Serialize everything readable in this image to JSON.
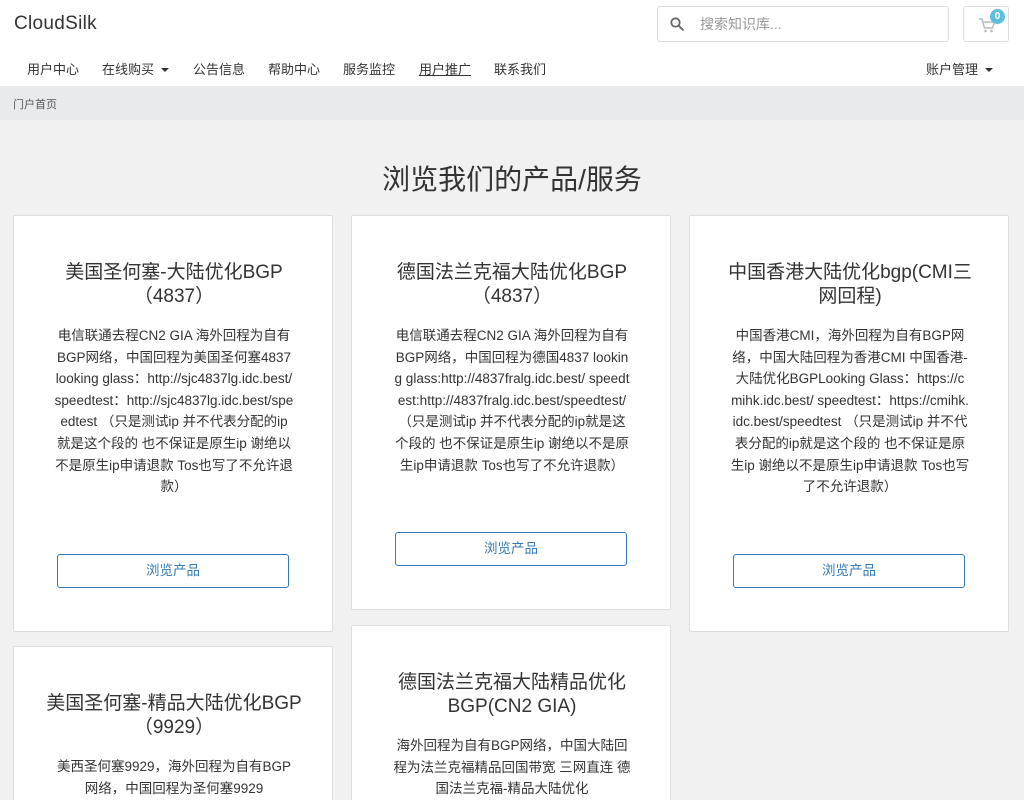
{
  "header": {
    "logo": "CloudSilk",
    "search_placeholder": "搜索知识库...",
    "cart_count": "0"
  },
  "nav": {
    "items": [
      {
        "label": "用户中心"
      },
      {
        "label": "在线购买"
      },
      {
        "label": "公告信息"
      },
      {
        "label": "帮助中心"
      },
      {
        "label": "服务监控"
      },
      {
        "label": "用户推广"
      },
      {
        "label": "联系我们"
      }
    ],
    "account": "账户管理"
  },
  "breadcrumb": "门户首页",
  "page_title": "浏览我们的产品/服务",
  "products": [
    {
      "title": "美国圣何塞-大陆优化BGP（4837）",
      "desc": "电信联通去程CN2 GIA 海外回程为自有BGP网络，中国回程为美国圣何塞4837 looking glass：http://sjc4837lg.idc.best/ speedtest：http://sjc4837lg.idc.best/speedtest （只是测试ip 并不代表分配的ip就是这个段的 也不保证是原生ip 谢绝以不是原生ip申请退款 Tos也写了不允许退款）",
      "button": "浏览产品"
    },
    {
      "title": "德国法兰克福大陆优化BGP（4837）",
      "desc": "电信联通去程CN2 GIA 海外回程为自有BGP网络，中国回程为德国4837 looking glass:http://4837fralg.idc.best/ speedtest:http://4837fralg.idc.best/speedtest/ （只是测试ip 并不代表分配的ip就是这个段的 也不保证是原生ip 谢绝以不是原生ip申请退款 Tos也写了不允许退款）",
      "button": "浏览产品"
    },
    {
      "title": "中国香港大陆优化bgp(CMI三网回程)",
      "desc": "中国香港CMI，海外回程为自有BGP网络，中国大陆回程为香港CMI 中国香港-大陆优化BGPLooking Glass：https://cmihk.idc.best/ speedtest：https://cmihk.idc.best/speedtest （只是测试ip 并不代表分配的ip就是这个段的 也不保证是原生ip 谢绝以不是原生ip申请退款 Tos也写了不允许退款）",
      "button": "浏览产品"
    },
    {
      "title": "美国圣何塞-精品大陆优化BGP（9929）",
      "desc": "美西圣何塞9929，海外回程为自有BGP网络，中国回程为圣何塞9929",
      "button": ""
    },
    {
      "title": "德国法兰克福大陆精品优化BGP(CN2 GIA)",
      "desc": "海外回程为自有BGP网络，中国大陆回程为法兰克福精品回国带宽 三网直连 德国法兰克福-精品大陆优化",
      "button": ""
    }
  ]
}
